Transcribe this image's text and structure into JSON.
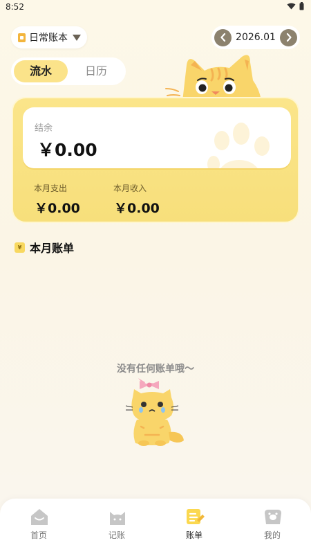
{
  "status_bar": {
    "time": "8:52"
  },
  "header": {
    "book_label": "日常账本",
    "month": "2026.01"
  },
  "tabs": [
    {
      "label": "流水",
      "active": true
    },
    {
      "label": "日历",
      "active": false
    }
  ],
  "summary": {
    "balance_label": "结余",
    "balance_value": "￥0.00",
    "expense_label": "本月支出",
    "expense_value": "￥0.00",
    "income_label": "本月收入",
    "income_value": "￥0.00"
  },
  "section": {
    "icon_text": "¥",
    "title": "本月账单"
  },
  "empty_state": {
    "text": "没有任何账单哦～"
  },
  "nav": [
    {
      "label": "首页",
      "icon": "home-icon",
      "active": false
    },
    {
      "label": "记账",
      "icon": "cat-face-icon",
      "active": false
    },
    {
      "label": "账单",
      "icon": "bill-icon",
      "active": true
    },
    {
      "label": "我的",
      "icon": "profile-icon",
      "active": false
    }
  ],
  "colors": {
    "accent": "#fbe38a",
    "card": "#f9e07f",
    "button_dark": "#8c826e",
    "text_muted": "#8c8c8c"
  }
}
